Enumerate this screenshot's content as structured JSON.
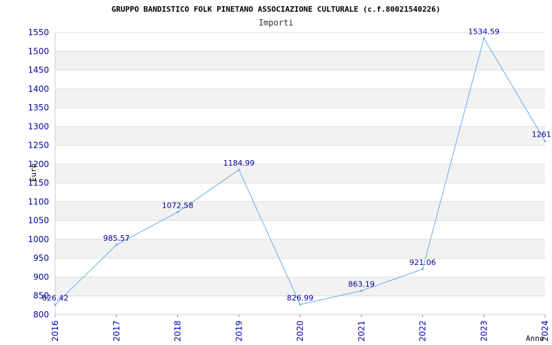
{
  "chart_data": {
    "type": "line",
    "title": "GRUPPO BANDISTICO FOLK PINETANO ASSOCIAZIONE CULTURALE (c.f.80021540226)",
    "subtitle": "Importi",
    "xlabel": "Anno",
    "ylabel": "Euro",
    "categories": [
      "2016",
      "2017",
      "2018",
      "2019",
      "2020",
      "2021",
      "2022",
      "2023",
      "2024"
    ],
    "series": [
      {
        "values": [
          826.42,
          985.57,
          1072.58,
          1184.99,
          826.99,
          863.19,
          921.06,
          1534.59,
          1261.0
        ],
        "labels": [
          "826.42",
          "985.57",
          "1072.58",
          "1184.99",
          "826.99",
          "863.19",
          "921.06",
          "1534.59",
          "1261.0"
        ]
      }
    ],
    "yticks": [
      "800",
      "850",
      "900",
      "950",
      "1000",
      "1050",
      "1100",
      "1150",
      "1200",
      "1250",
      "1300",
      "1350",
      "1400",
      "1450",
      "1500",
      "1550"
    ],
    "ylim": [
      800,
      1550
    ],
    "grid": true,
    "colors": {
      "line": "#66aaee",
      "band": "#f2f2f2",
      "gridline": "#dddddd",
      "tick_text": "#0000aa",
      "data_label": "#000099"
    }
  }
}
